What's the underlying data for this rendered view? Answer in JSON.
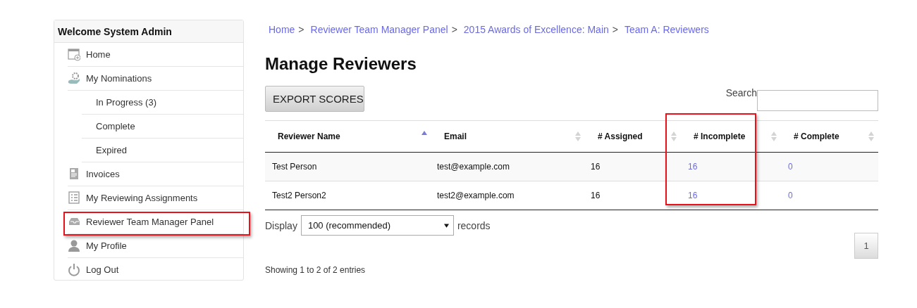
{
  "sidebar": {
    "title": "Welcome System Admin",
    "items": [
      {
        "label": "Home",
        "highlighted": false
      },
      {
        "label": "My Nominations",
        "highlighted": false,
        "children": [
          {
            "label": "In Progress (3)"
          },
          {
            "label": "Complete"
          },
          {
            "label": "Expired"
          }
        ]
      },
      {
        "label": "Invoices",
        "highlighted": false
      },
      {
        "label": "My Reviewing Assignments",
        "highlighted": false
      },
      {
        "label": "Reviewer Team Manager Panel",
        "highlighted": true
      },
      {
        "label": "My Profile",
        "highlighted": false
      },
      {
        "label": "Log Out",
        "highlighted": false
      }
    ]
  },
  "breadcrumb": [
    "Home",
    "Reviewer Team Manager Panel",
    "2015 Awards of Excellence: Main",
    "Team A: Reviewers"
  ],
  "breadcrumb_separator": ">",
  "page_title": "Manage Reviewers",
  "export_button": "EXPORT SCORES",
  "search": {
    "label": "Search"
  },
  "table": {
    "columns": [
      {
        "label": "Reviewer Name",
        "sorted": true,
        "highlighted": false,
        "kind": "text"
      },
      {
        "label": "Email",
        "sorted": false,
        "highlighted": false,
        "kind": "text"
      },
      {
        "label": "# Assigned",
        "sorted": false,
        "highlighted": false,
        "kind": "text"
      },
      {
        "label": "# Incomplete",
        "sorted": false,
        "highlighted": true,
        "kind": "link"
      },
      {
        "label": "# Complete",
        "sorted": false,
        "highlighted": false,
        "kind": "link"
      }
    ],
    "rows": [
      [
        "Test Person",
        "test@example.com",
        "16",
        "16",
        "0"
      ],
      [
        "Test2 Person2",
        "test2@example.com",
        "16",
        "16",
        "0"
      ]
    ]
  },
  "length": {
    "prefix": "Display",
    "value": "100 (recommended)",
    "suffix": "records"
  },
  "pages": [
    {
      "label": "1",
      "selected": true
    }
  ],
  "info": "Showing 1 to 2 of 2 entries"
}
